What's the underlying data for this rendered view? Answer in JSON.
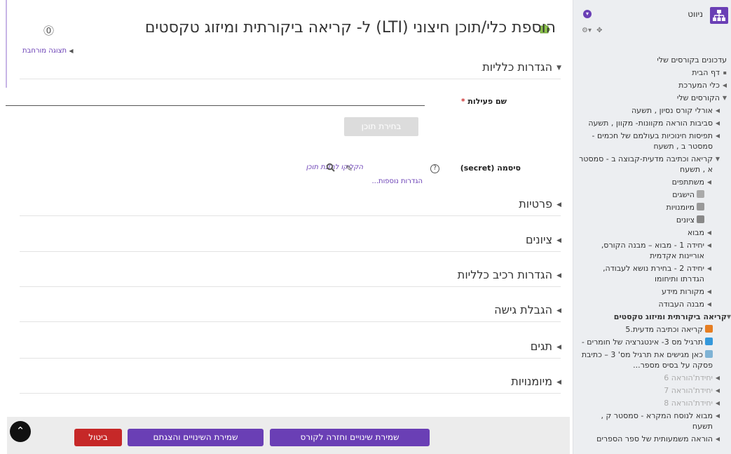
{
  "page": {
    "title": "הוספת כלי/תוכן חיצוני (LTI) ל- קריאה ביקורתית ומיזוג טקסטים",
    "expand_link": "תצוגה מורחבת"
  },
  "form": {
    "sections": [
      "הגדרות כלליות",
      "פרטיות",
      "ציונים",
      "הגדרות רכיב כלליות",
      "הגבלת גישה",
      "תגים",
      "מיומנויות"
    ],
    "activity_name_label": "שם פעילות",
    "required_marker": "*",
    "select_content_button": "בחירת תוכן",
    "secret_label": "סיסמה (secret)",
    "secret_help": "?",
    "secret_edit_link": "הקליקו להזנת תוכן",
    "more_settings_link": "הגדרות נוספות..."
  },
  "footer": {
    "save_return": "שמירת שינויים וחזרה לקורס",
    "save_display": "שמירת השינויים והצגתם",
    "cancel": "ביטול"
  },
  "nav": {
    "title": "ניווט",
    "items": [
      "עדכונים בקורסים שלי",
      "דף הבית",
      "כלי המערכת",
      "הקורסים שלי",
      "אורלי קורס נסיון , תשעה",
      "סביבות הוראה מקוונות- מקוון , תשעה",
      "תפיסות חינוכיות בעולמם של חכמים - סמסטר ב , תשעח",
      "קריאה וכתיבה מדעית-קבוצה ב - סמסטר א , תשעח",
      "משתתפים",
      "הישגים",
      "מיומנויות",
      "ציונים",
      "מבוא",
      "יחידה 1 - מבוא – מבנה הקורס, אוריינות אקדמית",
      "יחידה 2 - בחירת נושא לעבודה, הגדרתו ותיחומו",
      "מקורות מידע",
      "מבנה העבודה",
      "קריאה ביקורתית ומיזוג טקסטים",
      "קריאה וכתיבה מדעית.5",
      "תרגיל מס 3- אינטגרציה של חומרים -",
      "כאן מגישים את תרגיל מס' 3 – כתיבת פסקה על בסיס מספר...",
      "יחידת'הוראה 6",
      "יחידת'הוראה 7",
      "יחידת'הוראה 8",
      "מבוא לנוסח המקרא - סמסטר ק , תשעח",
      "הוראה משמעותית של ספר הספרים"
    ]
  },
  "colors": {
    "accent": "#6a3fb5",
    "danger": "#c62828",
    "nav_bg": "#eceef1"
  }
}
